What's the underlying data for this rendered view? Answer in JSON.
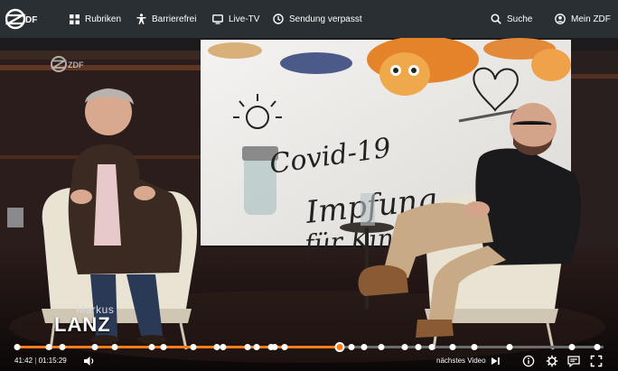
{
  "nav": {
    "logo_text": "ZDF",
    "items": [
      {
        "label": "Rubriken",
        "icon": "grid-icon"
      },
      {
        "label": "Barrierefrei",
        "icon": "accessibility-icon"
      },
      {
        "label": "Live-TV",
        "icon": "tv-icon"
      },
      {
        "label": "Sendung verpasst",
        "icon": "clock-icon"
      }
    ],
    "search_label": "Suche",
    "account_label": "Mein ZDF"
  },
  "video": {
    "watermark": "ZDF",
    "screen_text": [
      "Covid-19",
      "Impfung",
      "für Kinder"
    ],
    "show_first": "Markus",
    "show_last": "LANZ"
  },
  "player": {
    "current_time": "41:42",
    "duration": "01:15:29",
    "progress_fraction": 0.552,
    "next_label": "nächstes Video",
    "chapter_marker_fractions": [
      0.004,
      0.058,
      0.082,
      0.136,
      0.171,
      0.233,
      0.253,
      0.303,
      0.344,
      0.354,
      0.396,
      0.411,
      0.435,
      0.442,
      0.458,
      0.572,
      0.593,
      0.622,
      0.662,
      0.685,
      0.708,
      0.744,
      0.78,
      0.841,
      0.947,
      0.99
    ],
    "accent_color": "#fa7d19"
  }
}
